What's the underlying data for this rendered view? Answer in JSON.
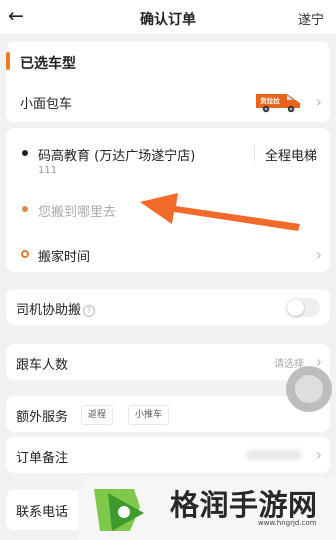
{
  "header": {
    "back_glyph": "←",
    "title": "确认订单",
    "city": "遂宁"
  },
  "vehicle": {
    "section_title": "已选车型",
    "name": "小面包车",
    "van_text": "货拉拉",
    "accent_color": "#f07a1f"
  },
  "route": {
    "start_address": "码高教育 (万达广场遂宁店)",
    "start_sub": "111",
    "elevator": "全程电梯",
    "destination_placeholder": "您搬到哪里去",
    "move_time_label": "搬家时间",
    "arrow_color": "#f26a2a"
  },
  "options": {
    "driver_help": "司机协助搬",
    "help_glyph": "?",
    "driver_help_on": false,
    "passengers_label": "跟车人数",
    "passengers_placeholder": "请选择",
    "extra_services_label": "额外服务",
    "extra_chips": [
      "返程",
      "小推车"
    ],
    "remarks_label": "订单备注",
    "contact_label": "联系电话"
  },
  "chevron_glyph": "›",
  "watermark": {
    "text": "格润手游网",
    "url": "www.hngrjd.com"
  }
}
